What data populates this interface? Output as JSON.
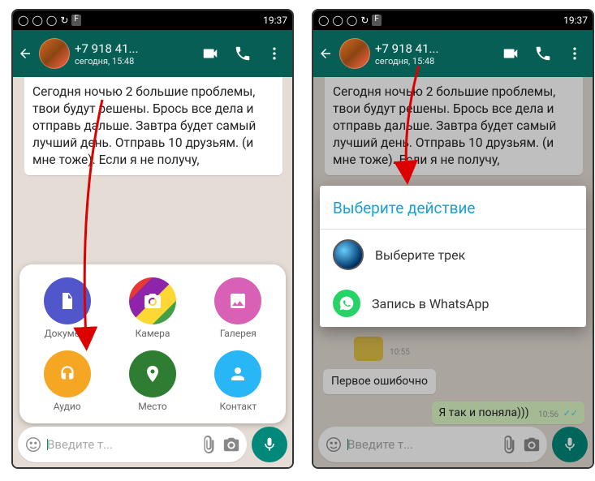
{
  "status": {
    "time": "19:37",
    "left_icons": [
      "○",
      "○",
      "○",
      "⟳",
      "F"
    ]
  },
  "header": {
    "contact": "+7 918 41...",
    "substatus": "сегодня, 15:48"
  },
  "message": "Сегодня ночью 2 большие проблемы, твои будут решены. Брось все дела и отправь дальше. Завтра будет самый лучший день. Отправь 10 друзьям. (и мне тоже). Если я не получу,",
  "attach": {
    "doc": "Документ",
    "cam": "Камера",
    "gal": "Галерея",
    "aud": "Аудио",
    "loc": "Место",
    "con": "Контакт"
  },
  "input_placeholder": "Введите т...",
  "dialog": {
    "title": "Выберите действие",
    "opt_track": "Выберите трек",
    "opt_record": "Запись в WhatsApp"
  },
  "chat2": {
    "sticker_time": "10:55",
    "msg_in": "Первое ошибочно",
    "msg_out": "Я так и поняла)))",
    "msg_out_time": "10:56"
  }
}
